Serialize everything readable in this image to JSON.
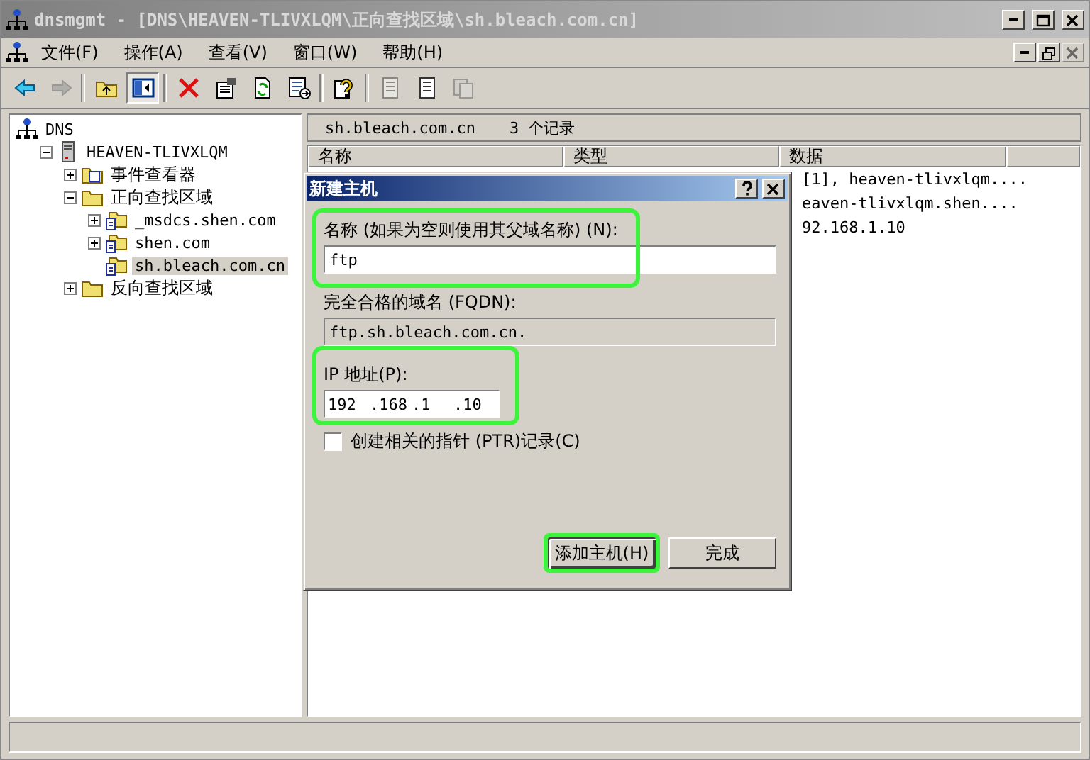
{
  "window": {
    "title": "dnsmgmt - [DNS\\HEAVEN-TLIVXLQM\\正向查找区域\\sh.bleach.com.cn]"
  },
  "menu": [
    {
      "label": "文件(F)"
    },
    {
      "label": "操作(A)"
    },
    {
      "label": "查看(V)"
    },
    {
      "label": "窗口(W)"
    },
    {
      "label": "帮助(H)"
    }
  ],
  "toolbar": [
    {
      "kind": "back",
      "disabled": false,
      "pressed": false
    },
    {
      "kind": "forward",
      "disabled": true,
      "pressed": false
    },
    {
      "kind": "sep"
    },
    {
      "kind": "up",
      "disabled": false,
      "pressed": false
    },
    {
      "kind": "tree",
      "disabled": false,
      "pressed": true
    },
    {
      "kind": "sep"
    },
    {
      "kind": "delete",
      "disabled": false,
      "pressed": false
    },
    {
      "kind": "properties",
      "disabled": false,
      "pressed": false
    },
    {
      "kind": "refresh",
      "disabled": false,
      "pressed": false
    },
    {
      "kind": "export",
      "disabled": false,
      "pressed": false
    },
    {
      "kind": "sep"
    },
    {
      "kind": "help",
      "disabled": false,
      "pressed": false
    },
    {
      "kind": "sep"
    },
    {
      "kind": "page",
      "disabled": true,
      "pressed": false
    },
    {
      "kind": "page",
      "disabled": false,
      "pressed": false
    },
    {
      "kind": "pages",
      "disabled": true,
      "pressed": false
    }
  ],
  "tree": [
    {
      "label": "DNS",
      "kind": "dns",
      "selected": false,
      "children": [
        {
          "label": "HEAVEN-TLIVXLQM",
          "kind": "server",
          "expanded": true,
          "selected": false,
          "children": [
            {
              "label": "事件查看器",
              "kind": "log",
              "expanded": false,
              "selected": false
            },
            {
              "label": "正向查找区域",
              "kind": "folder",
              "expanded": true,
              "selected": false,
              "children": [
                {
                  "label": "_msdcs.shen.com",
                  "kind": "zone",
                  "expanded": false,
                  "selected": false
                },
                {
                  "label": "shen.com",
                  "kind": "zone",
                  "expanded": false,
                  "selected": false
                },
                {
                  "label": "sh.bleach.com.cn",
                  "kind": "zone",
                  "selected": true
                }
              ]
            },
            {
              "label": "反向查找区域",
              "kind": "folder",
              "expanded": false,
              "selected": false
            }
          ]
        }
      ]
    }
  ],
  "records": {
    "zone": "sh.bleach.com.cn",
    "count": "3 个记录",
    "columns": [
      "名称",
      "类型",
      "数据"
    ],
    "rows": [
      {
        "data": "[1], heaven-tlivxlqm...."
      },
      {
        "data": "eaven-tlivxlqm.shen...."
      },
      {
        "data": "92.168.1.10"
      }
    ]
  },
  "dialog": {
    "title": "新建主机",
    "name_label": "名称 (如果为空则使用其父域名称) (N):",
    "name_value": "ftp",
    "fqdn_label": "完全合格的域名 (FQDN):",
    "fqdn_value": "ftp.sh.bleach.com.cn.",
    "ip_label": "IP 地址(P):",
    "ip_octets": [
      "192",
      ".168",
      ".1",
      ".10"
    ],
    "ptr": {
      "label": "创建相关的指针 (PTR)记录(C)",
      "checked": false
    },
    "buttons": [
      {
        "label": "添加主机(H)",
        "highlighted": true
      },
      {
        "label": "完成",
        "highlighted": false
      }
    ]
  }
}
